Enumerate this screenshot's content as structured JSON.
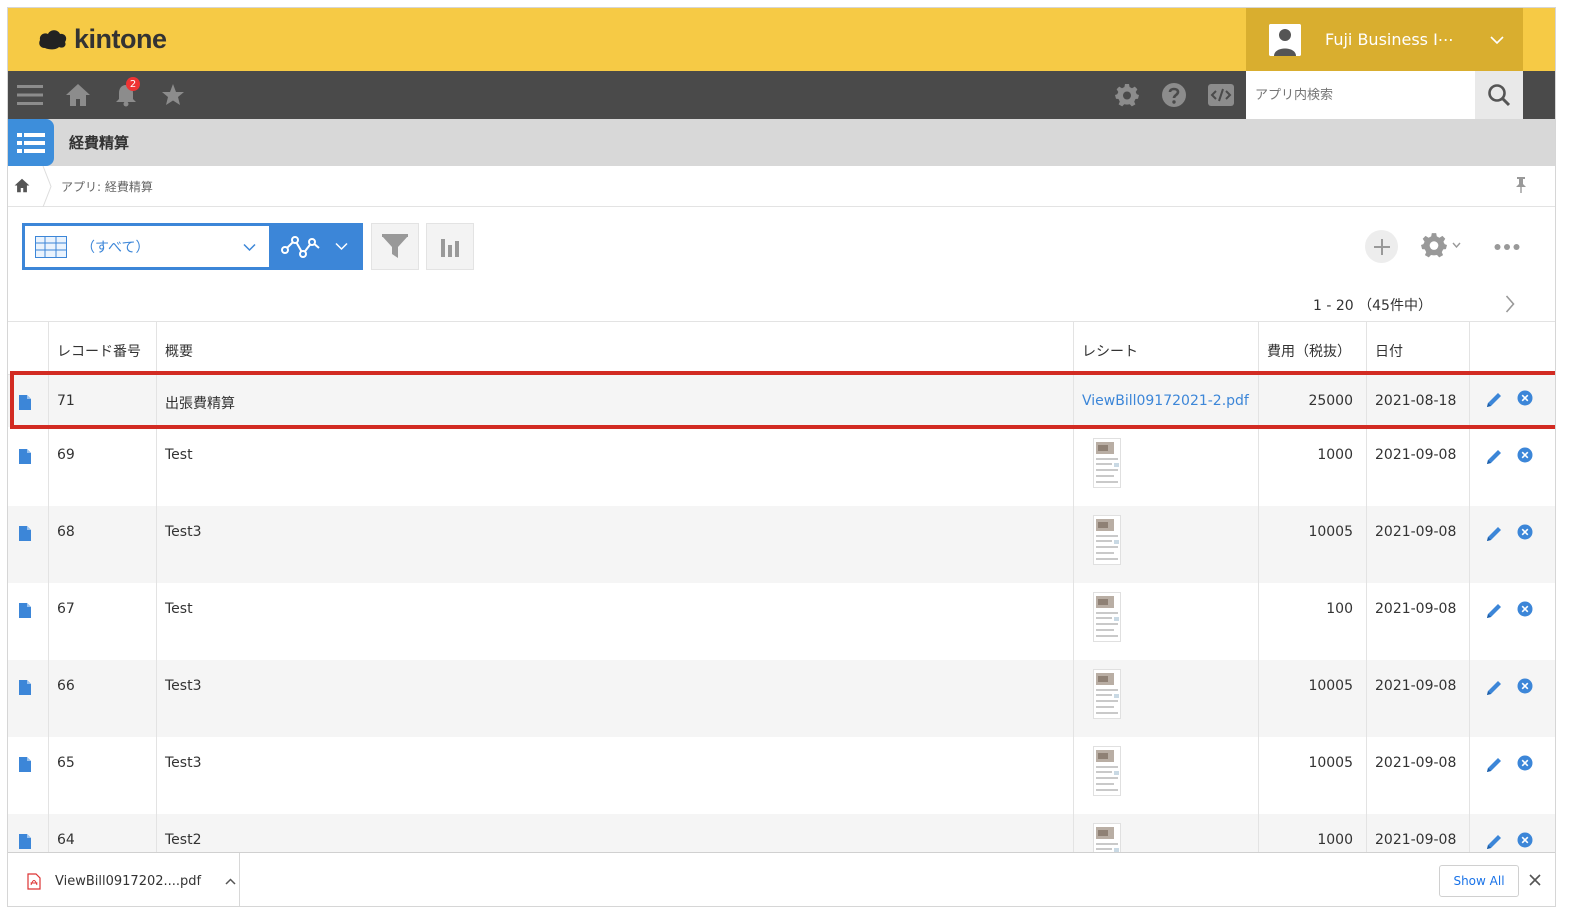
{
  "header": {
    "logo_text": "kintone",
    "user_name": "Fuji Business I⋯"
  },
  "nav": {
    "notification_count": "2",
    "search_placeholder": "アプリ内検索"
  },
  "app": {
    "title": "経費精算",
    "breadcrumb": "アプリ: 経費精算"
  },
  "toolbar": {
    "view_name": "（すべて）"
  },
  "pager": {
    "text": "1 - 20 （45件中）"
  },
  "table": {
    "headers": [
      "レコード番号",
      "概要",
      "レシート",
      "費用（税抜）",
      "日付"
    ],
    "rows": [
      {
        "id": "71",
        "summary": "出張費精算",
        "receipt": "ViewBill09172021-2.pdf",
        "cost": "25000",
        "date": "2021-08-18"
      },
      {
        "id": "69",
        "summary": "Test",
        "receipt": "",
        "cost": "1000",
        "date": "2021-09-08"
      },
      {
        "id": "68",
        "summary": "Test3",
        "receipt": "",
        "cost": "10005",
        "date": "2021-09-08"
      },
      {
        "id": "67",
        "summary": "Test",
        "receipt": "",
        "cost": "100",
        "date": "2021-09-08"
      },
      {
        "id": "66",
        "summary": "Test3",
        "receipt": "",
        "cost": "10005",
        "date": "2021-09-08"
      },
      {
        "id": "65",
        "summary": "Test3",
        "receipt": "",
        "cost": "10005",
        "date": "2021-09-08"
      },
      {
        "id": "64",
        "summary": "Test2",
        "receipt": "",
        "cost": "1000",
        "date": "2021-09-08"
      }
    ]
  },
  "download_bar": {
    "file_name": "ViewBill0917202....pdf",
    "show_all": "Show All"
  },
  "colors": {
    "header_yellow": "#f6ca45",
    "nav_dark": "#4a4a4a",
    "accent_blue": "#3c86d8",
    "highlight_red": "#d22b22"
  }
}
